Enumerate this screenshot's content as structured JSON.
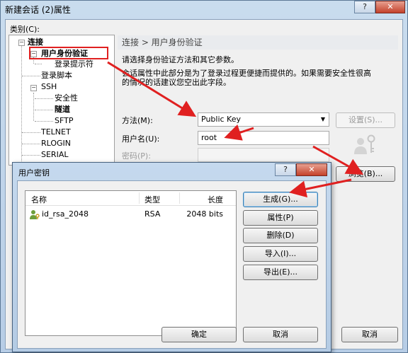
{
  "window": {
    "title": "新建会话 (2)属性",
    "help_glyph": "?",
    "close_glyph": "✕",
    "category_label": "类别(C):"
  },
  "tree": {
    "root": "连接",
    "auth": "用户身份验证",
    "login_prompt": "登录提示符",
    "login_script": "登录脚本",
    "ssh": "SSH",
    "security": "安全性",
    "tunnel": "隧道",
    "sftp": "SFTP",
    "telnet": "TELNET",
    "rlogin": "RLOGIN",
    "serial": "SERIAL",
    "expand_minus": "−"
  },
  "panel": {
    "title": "连接 > 用户身份验证",
    "desc1": "请选择身份验证方法和其它参数。",
    "desc2": "会话属性中此部分是为了登录过程更便捷而提供的。如果需要安全性很高",
    "desc3": "的情况的话建议您空出此字段。",
    "method_label": "方法(M):",
    "method_value": "Public Key",
    "settings_button": "设置(S)...",
    "username_label": "用户名(U):",
    "username_value": "root",
    "password_label": "密码(P):",
    "browse_button": "浏览(B)...",
    "cancel_button": "取消"
  },
  "dialog": {
    "title": "用户密钥",
    "help_glyph": "?",
    "close_glyph": "✕",
    "columns": [
      "名称",
      "类型",
      "长度"
    ],
    "rows": [
      {
        "name": "id_rsa_2048",
        "type": "RSA",
        "length": "2048 bits"
      }
    ],
    "buttons": {
      "generate": "生成(G)...",
      "properties": "属性(P)",
      "delete": "删除(D)",
      "import": "导入(I)...",
      "export": "导出(E)..."
    },
    "ok": "确定",
    "cancel": "取消"
  },
  "colors": {
    "annotation": "#e02020",
    "title_bar": "#b9cfe7"
  }
}
